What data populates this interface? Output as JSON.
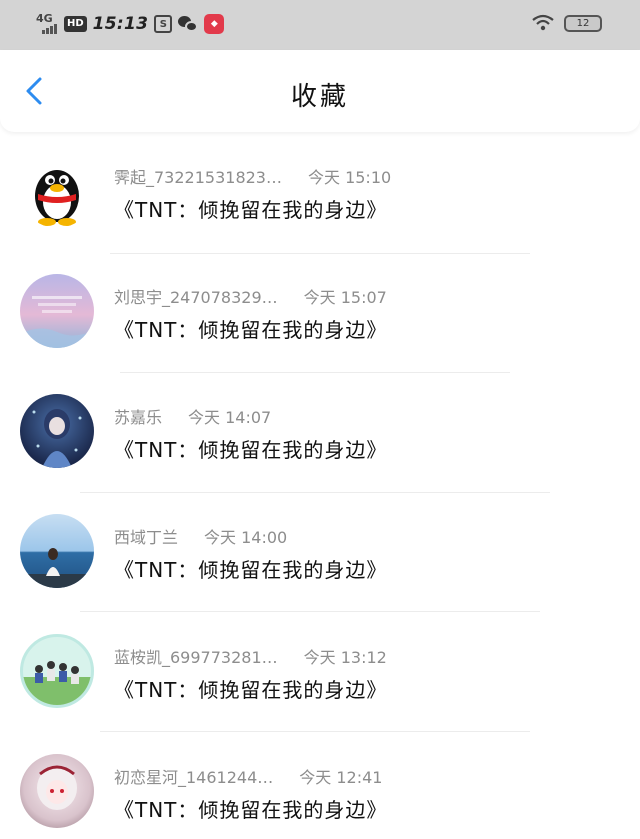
{
  "status_bar": {
    "network": "4G",
    "hd": "HD",
    "time": "15:13",
    "s_icon": "S",
    "battery": "12",
    "icons": [
      "signal-icon",
      "hd-icon",
      "s-app-icon",
      "wechat-icon",
      "red-app-icon",
      "wifi-icon",
      "battery-icon"
    ]
  },
  "header": {
    "title": "收藏",
    "back_icon": "chevron-left-icon"
  },
  "colors": {
    "accent": "#2d8cf0",
    "status_bar_bg": "#d4d4d4",
    "meta_text": "#8d8d8d"
  },
  "items": [
    {
      "name": "霁起_73221531823…",
      "time": "今天 15:10",
      "message": "《TNT：倾挽留在我的身边》",
      "avatar": "qq-penguin-avatar"
    },
    {
      "name": "刘思宇_247078329…",
      "time": "今天 15:07",
      "message": "《TNT：倾挽留在我的身边》",
      "avatar": "pink-sky-avatar"
    },
    {
      "name": "苏嘉乐",
      "time": "今天 14:07",
      "message": "《TNT：倾挽留在我的身边》",
      "avatar": "anime-girl-avatar"
    },
    {
      "name": "西域丁兰",
      "time": "今天 14:00",
      "message": "《TNT：倾挽留在我的身边》",
      "avatar": "seaside-girl-avatar"
    },
    {
      "name": "蓝桉凯_699773281…",
      "time": "今天 13:12",
      "message": "《TNT：倾挽留在我的身边》",
      "avatar": "group-photo-avatar"
    },
    {
      "name": "初恋星河_1461244…",
      "time": "今天 12:41",
      "message": "《TNT：倾挽留在我的身边》",
      "avatar": "white-hair-anime-avatar"
    }
  ]
}
